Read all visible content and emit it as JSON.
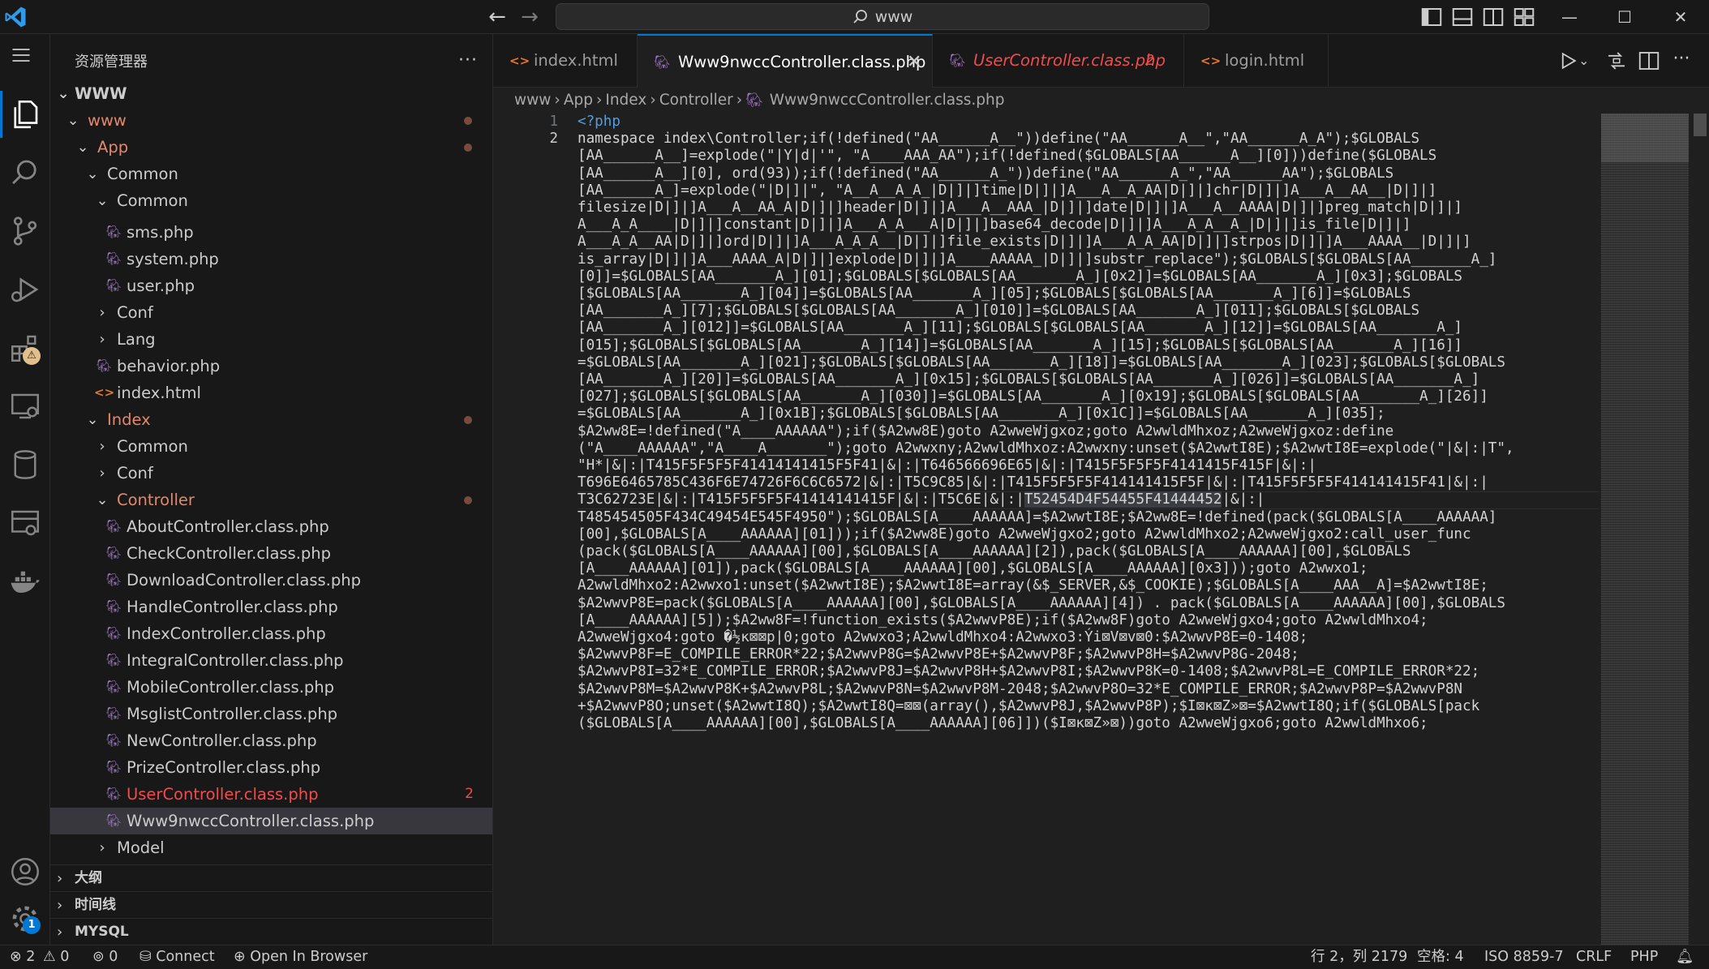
{
  "titlebar": {
    "search_text": "www"
  },
  "sidebar": {
    "title": "资源管理器",
    "more": "···",
    "root": "WWW",
    "tree": [
      {
        "label": "www",
        "depth": 1,
        "type": "folder-open",
        "style": "mod",
        "dot": true
      },
      {
        "label": "App",
        "depth": 2,
        "type": "folder-open",
        "style": "mod",
        "dot": true
      },
      {
        "label": "Common",
        "depth": 3,
        "type": "folder-open",
        "style": "",
        "dot": false
      },
      {
        "label": "Common",
        "depth": 4,
        "type": "folder-open",
        "style": "",
        "dot": false
      },
      {
        "label": "sms.php",
        "depth": 5,
        "type": "php",
        "style": "",
        "dot": false
      },
      {
        "label": "system.php",
        "depth": 5,
        "type": "php",
        "style": "",
        "dot": false
      },
      {
        "label": "user.php",
        "depth": 5,
        "type": "php",
        "style": "",
        "dot": false
      },
      {
        "label": "Conf",
        "depth": 4,
        "type": "folder",
        "style": "",
        "dot": false
      },
      {
        "label": "Lang",
        "depth": 4,
        "type": "folder",
        "style": "",
        "dot": false
      },
      {
        "label": "behavior.php",
        "depth": 4,
        "type": "php",
        "style": "",
        "dot": false
      },
      {
        "label": "index.html",
        "depth": 4,
        "type": "html",
        "style": "",
        "dot": false
      },
      {
        "label": "Index",
        "depth": 3,
        "type": "folder-open",
        "style": "mod",
        "dot": true
      },
      {
        "label": "Common",
        "depth": 4,
        "type": "folder",
        "style": "",
        "dot": false
      },
      {
        "label": "Conf",
        "depth": 4,
        "type": "folder",
        "style": "",
        "dot": false
      },
      {
        "label": "Controller",
        "depth": 4,
        "type": "folder-open",
        "style": "mod",
        "dot": true
      },
      {
        "label": "AboutController.class.php",
        "depth": 5,
        "type": "php",
        "style": "",
        "dot": false
      },
      {
        "label": "CheckController.class.php",
        "depth": 5,
        "type": "php",
        "style": "",
        "dot": false
      },
      {
        "label": "DownloadController.class.php",
        "depth": 5,
        "type": "php",
        "style": "",
        "dot": false
      },
      {
        "label": "HandleController.class.php",
        "depth": 5,
        "type": "php",
        "style": "",
        "dot": false
      },
      {
        "label": "IndexController.class.php",
        "depth": 5,
        "type": "php",
        "style": "",
        "dot": false
      },
      {
        "label": "IntegralController.class.php",
        "depth": 5,
        "type": "php",
        "style": "",
        "dot": false
      },
      {
        "label": "MobileController.class.php",
        "depth": 5,
        "type": "php",
        "style": "",
        "dot": false
      },
      {
        "label": "MsglistController.class.php",
        "depth": 5,
        "type": "php",
        "style": "",
        "dot": false
      },
      {
        "label": "NewController.class.php",
        "depth": 5,
        "type": "php",
        "style": "",
        "dot": false
      },
      {
        "label": "PrizeController.class.php",
        "depth": 5,
        "type": "php",
        "style": "",
        "dot": false
      },
      {
        "label": "UserController.class.php",
        "depth": 5,
        "type": "php",
        "style": "err",
        "dot": false,
        "count": "2"
      },
      {
        "label": "Www9nwccController.class.php",
        "depth": 5,
        "type": "php",
        "style": "",
        "dot": false,
        "selected": true
      },
      {
        "label": "Model",
        "depth": 4,
        "type": "folder",
        "style": "",
        "dot": false
      }
    ],
    "sections": [
      "大纲",
      "时间线",
      "MYSQL"
    ]
  },
  "tabs": [
    {
      "label": "index.html",
      "icon": "html",
      "style": ""
    },
    {
      "label": "Www9nwccController.class.php",
      "icon": "php",
      "style": "active",
      "close": "✕"
    },
    {
      "label": "UserController.class.php",
      "icon": "php",
      "style": "err",
      "count": "2"
    },
    {
      "label": "login.html",
      "icon": "html",
      "style": ""
    }
  ],
  "breadcrumb": [
    "www",
    "App",
    "Index",
    "Controller",
    "Www9nwccController.class.php"
  ],
  "editor": {
    "line_numbers": [
      "1",
      "2"
    ],
    "lines": [
      "<?php",
      "namespace index\\Controller;if(!defined(\"AA______A__\"))define(\"AA______A__\",\"AA______A_A\");$GLOBALS",
      "[AA______A__]=explode(\"|Y|d|'\", \"A____AAA_AA\");if(!defined($GLOBALS[AA______A__][0]))define($GLOBALS",
      "[AA______A__][0], ord(93));if(!defined(\"AA______A_\"))define(\"AA______A_\",\"AA______AA\");$GLOBALS",
      "[AA______A_]=explode(\"|D|]|\", \"A__A__A_A_|D|]|]time|D|]|]A___A__A_AA|D|]|]chr|D|]|]A___A__AA__|D|]|]",
      "filesize|D|]|]A___A__AA_A|D|]|]header|D|]|]A___A__AAA_|D|]|]date|D|]|]A___A__AAAA|D|]|]preg_match|D|]|]",
      "A___A_A____|D|]|]constant|D|]|]A___A_A___A|D|]|]base64_decode|D|]|]A___A_A__A_|D|]|]is_file|D|]|]",
      "A___A_A__AA|D|]|]ord|D|]|]A___A_A_A__|D|]|]file_exists|D|]|]A___A_A_AA|D|]|]strpos|D|]|]A___AAAA__|D|]|]",
      "is_array|D|]|]A___AAAA_A|D|]|]explode|D|]|]A____AAAAA_|D|]|]substr_replace\");$GLOBALS[$GLOBALS[AA_______A_]",
      "[0]]=$GLOBALS[AA_______A_][01];$GLOBALS[$GLOBALS[AA_______A_][0x2]]=$GLOBALS[AA_______A_][0x3];$GLOBALS",
      "[$GLOBALS[AA_______A_][04]]=$GLOBALS[AA_______A_][05];$GLOBALS[$GLOBALS[AA_______A_][6]]=$GLOBALS",
      "[AA_______A_][7];$GLOBALS[$GLOBALS[AA_______A_][010]]=$GLOBALS[AA_______A_][011];$GLOBALS[$GLOBALS",
      "[AA_______A_][012]]=$GLOBALS[AA_______A_][11];$GLOBALS[$GLOBALS[AA_______A_][12]]=$GLOBALS[AA_______A_]",
      "[015];$GLOBALS[$GLOBALS[AA_______A_][14]]=$GLOBALS[AA_______A_][15];$GLOBALS[$GLOBALS[AA_______A_][16]]",
      "=$GLOBALS[AA_______A_][021];$GLOBALS[$GLOBALS[AA_______A_][18]]=$GLOBALS[AA_______A_][023];$GLOBALS[$GLOBALS",
      "[AA_______A_][20]]=$GLOBALS[AA_______A_][0x15];$GLOBALS[$GLOBALS[AA_______A_][026]]=$GLOBALS[AA_______A_]",
      "[027];$GLOBALS[$GLOBALS[AA_______A_][030]]=$GLOBALS[AA_______A_][0x19];$GLOBALS[$GLOBALS[AA_______A_][26]]",
      "=$GLOBALS[AA_______A_][0x1B];$GLOBALS[$GLOBALS[AA_______A_][0x1C]]=$GLOBALS[AA_______A_][035];",
      "$A2ww8E=!defined(\"A____AAAAAA\");if($A2ww8E)goto A2wweWjgxoz;goto A2wwldMhxoz;A2wweWjgxoz:define",
      "(\"A____AAAAAA\",\"A____A_______\");goto A2wwxny;A2wwldMhxoz:A2wwxny:unset($A2wwtI8E);$A2wwtI8E=explode(\"|&|:|T\",",
      "\"H*|&|:|T415F5F5F5F41414141415F5F41|&|:|T646566696E65|&|:|T415F5F5F5F4141415F415F|&|:|",
      "T696E6465785C436F6E74726F6C6C6572|&|:|T5C9C85|&|:|T415F5F5F5F414141415F5F|&|:|T415F5F5F5F414141415F41|&|:|",
      "T3C62723E|&|:|T415F5F5F5F41414141415F|&|:|T5C6E|&|:|T52454D4F54455F41444452|&|:|",
      "T485454505F434C49454E545F4950\");$GLOBALS[A____AAAAAA]=$A2wwtI8E;$A2ww8E=!defined(pack($GLOBALS[A____AAAAAA]",
      "[00],$GLOBALS[A____AAAAAA][01]));if($A2ww8E)goto A2wweWjgxo2;goto A2wwldMhxo2;A2wweWjgxo2:call_user_func",
      "(pack($GLOBALS[A____AAAAAA][00],$GLOBALS[A____AAAAAA][2]),pack($GLOBALS[A____AAAAAA][00],$GLOBALS",
      "[A____AAAAAA][01]),pack($GLOBALS[A____AAAAAA][00],$GLOBALS[A____AAAAAA][0x3]));goto A2wwxo1;",
      "A2wwldMhxo2:A2wwxo1:unset($A2wwtI8E);$A2wwtI8E=array(&$_SERVER,&$_COOKIE);$GLOBALS[A____AAA__A]=$A2wwtI8E;",
      "$A2wwvP8E=pack($GLOBALS[A____AAAAAA][00],$GLOBALS[A____AAAAAA][4]) . pack($GLOBALS[A____AAAAAA][00],$GLOBALS",
      "[A____AAAAAA][5]);$A2ww8F=!function_exists($A2wwvP8E);if($A2ww8F)goto A2wweWjgxo4;goto A2wwldMhxo4;",
      "A2wweWjgxo4:goto �½κ⊠⊠p|0;goto A2wwxo3;A2wwldMhxo4:A2wwxo3:Ýi⊠V⊠v⊠0:$A2wwvP8E=0-1408;",
      "$A2wwvP8F=E_COMPILE_ERROR*22;$A2wwvP8G=$A2wwvP8E+$A2wwvP8F;$A2wwvP8H=$A2wwvP8G-2048;",
      "$A2wwvP8I=32*E_COMPILE_ERROR;$A2wwvP8J=$A2wwvP8H+$A2wwvP8I;$A2wwvP8K=0-1408;$A2wwvP8L=E_COMPILE_ERROR*22;",
      "$A2wwvP8M=$A2wwvP8K+$A2wwvP8L;$A2wwvP8N=$A2wwvP8M-2048;$A2wwvP8O=32*E_COMPILE_ERROR;$A2wwvP8P=$A2wwvP8N",
      "+$A2wwvP8O;unset($A2wwtI8Q);$A2wwtI8Q=⊠⊠(array(),$A2wwvP8J,$A2wwvP8P);$I⊠κ⊠Z»⊠=$A2wwtI8Q;if($GLOBALS[pack",
      "($GLOBALS[A____AAAAAA][00],$GLOBALS[A____AAAAAA][06]])($I⊠κ⊠Z»⊠))goto A2wweWjgxo6;goto A2wwldMhxo6;"
    ],
    "selection": "T52454D4F54455F41444452"
  },
  "statusbar": {
    "errors": "2",
    "warnings": "0",
    "ports": "0",
    "connect": "Connect",
    "open_browser": "Open In Browser",
    "position": "行 2，列 2179",
    "spaces": "空格: 4",
    "encoding": "ISO 8859-7",
    "eol": "CRLF",
    "language": "PHP"
  },
  "colors": {
    "accent": "#0078d4",
    "modified": "#e2886c",
    "error": "#f14c4c",
    "php_icon": "#a074c4",
    "html_icon": "#e37933"
  }
}
